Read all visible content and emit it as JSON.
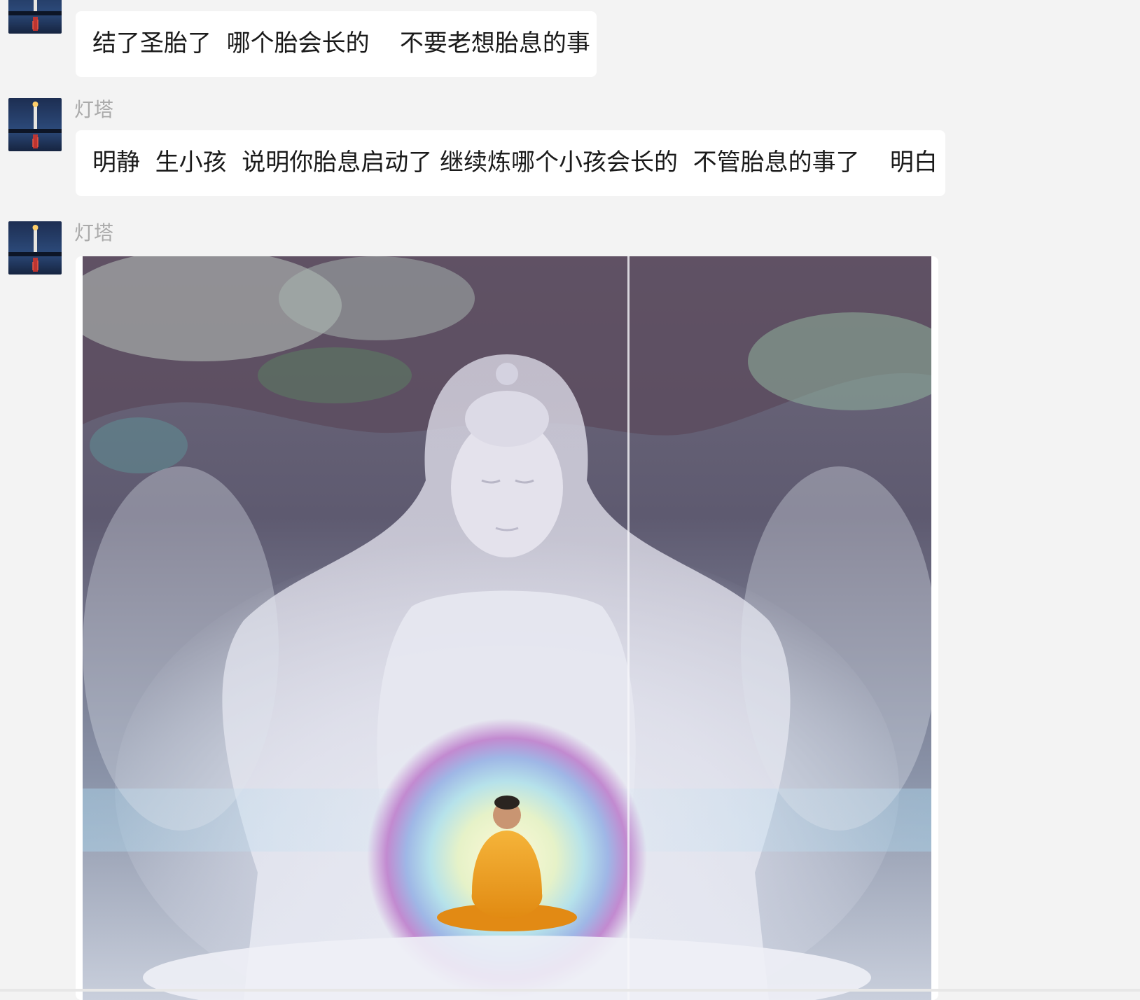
{
  "messages": [
    {
      "sender": "",
      "text": "结了圣胎了  哪个胎会长的    不要老想胎息的事"
    },
    {
      "sender": "灯塔",
      "text": "明静  生小孩  说明你胎息启动了 继续炼哪个小孩会长的  不管胎息的事了    明白"
    },
    {
      "sender": "灯塔",
      "image": "buddha-meditation-image"
    }
  ],
  "icons": {
    "avatar": "lighthouse-icon"
  },
  "colors": {
    "background": "#f3f3f3",
    "bubble": "#ffffff",
    "sender_name": "#aaaaaa",
    "text": "#1a1a1a"
  }
}
